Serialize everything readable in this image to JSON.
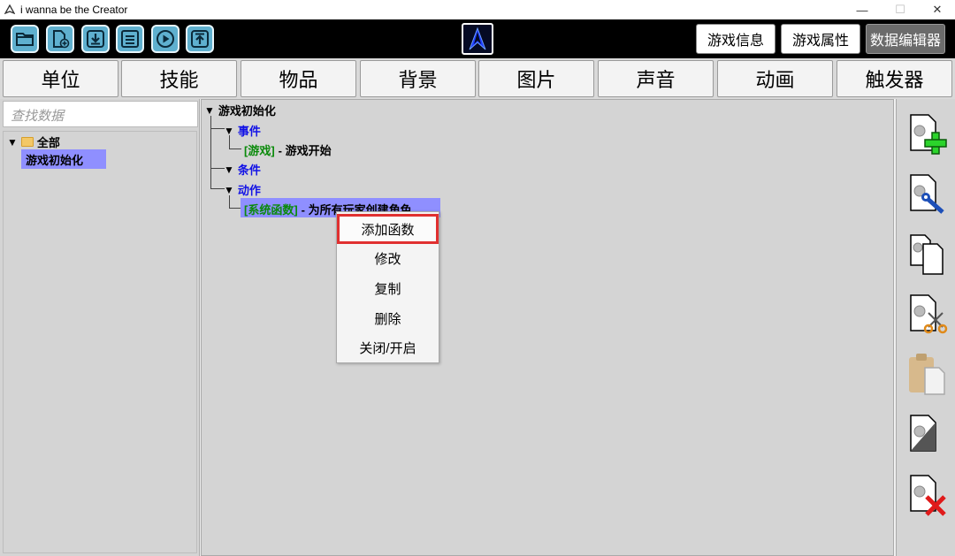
{
  "window": {
    "title": "i wanna be the Creator",
    "minimize": "—",
    "maximize": "☐",
    "close": "✕"
  },
  "toolbar": {
    "buttons": [
      "open-folder-icon",
      "new-file-icon",
      "download-icon",
      "save-icon",
      "play-icon",
      "upload-icon"
    ],
    "right": {
      "game_info": "游戏信息",
      "game_props": "游戏属性",
      "data_editor": "数据编辑器"
    }
  },
  "tabs": [
    "单位",
    "技能",
    "物品",
    "背景",
    "图片",
    "声音",
    "动画",
    "触发器"
  ],
  "left": {
    "search_placeholder": "查找数据",
    "root": "全部",
    "selected": "游戏初始化"
  },
  "tree": {
    "root": "游戏初始化",
    "events_label": "事件",
    "event_tag": "[游戏]",
    "event_text": "- 游戏开始",
    "conditions_label": "条件",
    "actions_label": "动作",
    "action_tag": "[系统函数]",
    "action_text": "- 为所有玩家创建角色"
  },
  "context_menu": {
    "items": [
      "添加函数",
      "修改",
      "复制",
      "删除",
      "关闭/开启"
    ],
    "highlighted": "添加函数"
  },
  "right_icons": [
    "add-function-icon",
    "edit-function-icon",
    "copy-function-icon",
    "cut-function-icon",
    "paste-function-icon",
    "toggle-function-icon",
    "delete-function-icon"
  ],
  "colors": {
    "selection": "#8f8fff",
    "highlight_border": "#e03030",
    "tree_keyword": "#1212e6",
    "tree_tag": "#0a8a0a",
    "toolbar_button": "#5fb0cf"
  }
}
